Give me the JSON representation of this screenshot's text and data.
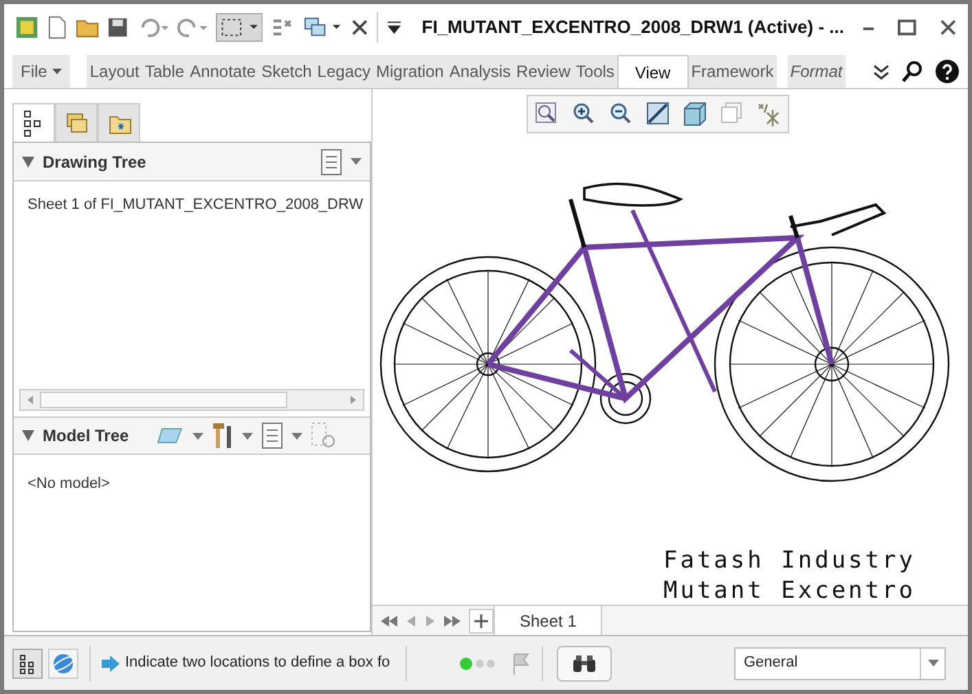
{
  "window": {
    "title": "FI_MUTANT_EXCENTRO_2008_DRW1 (Active) - ..."
  },
  "ribbon_tabs": [
    {
      "label": "File",
      "kind": "menu",
      "selected": false
    },
    {
      "label": "Layout",
      "kind": "tab",
      "selected": false
    },
    {
      "label": "Table",
      "kind": "tab",
      "selected": false
    },
    {
      "label": "Annotate",
      "kind": "tab",
      "selected": false
    },
    {
      "label": "Sketch",
      "kind": "tab",
      "selected": false
    },
    {
      "label": "Legacy",
      "kind": "tab",
      "selected": false
    },
    {
      "label": "Migration",
      "kind": "tab",
      "selected": false
    },
    {
      "label": "Analysis",
      "kind": "tab",
      "selected": false
    },
    {
      "label": "Review",
      "kind": "tab",
      "selected": false
    },
    {
      "label": "Tools",
      "kind": "tab",
      "selected": false
    },
    {
      "label": "View",
      "kind": "tab",
      "selected": true
    },
    {
      "label": "Framework",
      "kind": "tab",
      "selected": false
    },
    {
      "label": "Format",
      "kind": "contextual",
      "selected": false
    }
  ],
  "navigator_tabs": [
    {
      "selected": true
    },
    {
      "selected": false
    },
    {
      "selected": false
    }
  ],
  "drawing_tree": {
    "title": "Drawing Tree",
    "items": [
      "Sheet 1 of FI_MUTANT_EXCENTRO_2008_DRW"
    ]
  },
  "model_tree": {
    "title": "Model Tree",
    "empty_text": "<No model>"
  },
  "drawing": {
    "title_block": [
      "Fatash Industry",
      "Mutant Excentro"
    ]
  },
  "sheets": [
    {
      "label": "Sheet 1",
      "selected": true
    }
  ],
  "status_bar": {
    "message": "Indicate two locations to define a box fo",
    "filter": "General"
  }
}
